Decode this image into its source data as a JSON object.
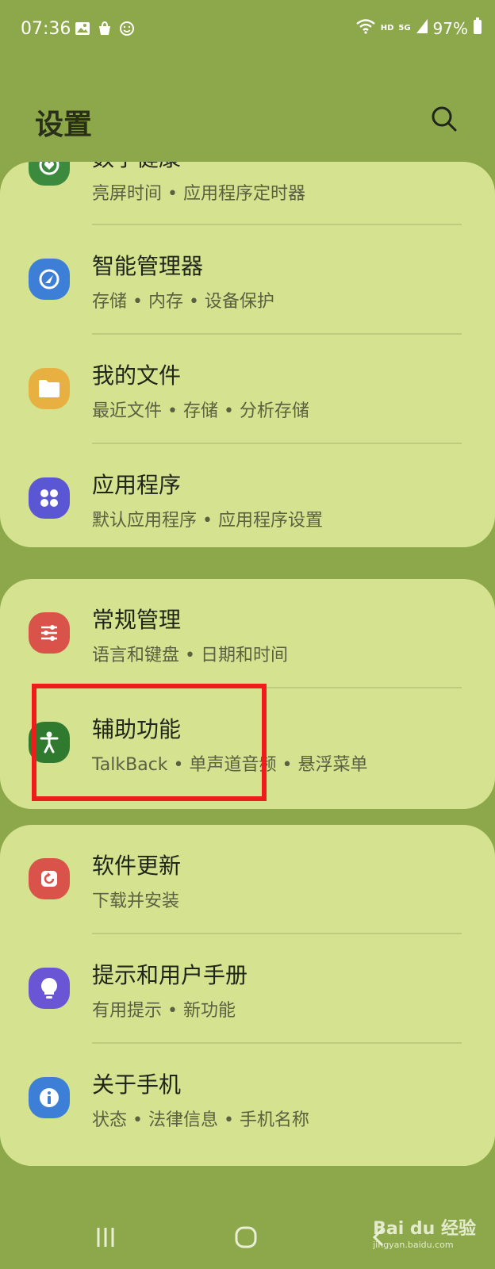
{
  "status_bar": {
    "time": "07:36",
    "network_tag_hd": "HD",
    "network_tag_5g": "5G",
    "battery": "97%",
    "left_icons": [
      "image-icon",
      "shopping-bag-icon",
      "smiley-icon"
    ],
    "right_icons": [
      "wifi-icon",
      "signal-icon",
      "battery-icon"
    ]
  },
  "header": {
    "title": "设置",
    "search_icon": "search-icon"
  },
  "group1": {
    "items": [
      {
        "title": "数字健康",
        "subtitle": "亮屏时间 • 应用程序定时器",
        "icon": "digital-wellbeing-icon",
        "color": "#3c8a3e"
      },
      {
        "title": "智能管理器",
        "subtitle": "存储 • 内存 • 设备保护",
        "icon": "device-care-icon",
        "color": "#3d7fd6"
      },
      {
        "title": "我的文件",
        "subtitle": "最近文件 • 存储 • 分析存储",
        "icon": "folder-icon",
        "color": "#e8b040"
      },
      {
        "title": "应用程序",
        "subtitle": "默认应用程序 • 应用程序设置",
        "icon": "apps-icon",
        "color": "#5a56d4"
      }
    ]
  },
  "group2": {
    "items": [
      {
        "title": "常规管理",
        "subtitle": "语言和键盘 • 日期和时间",
        "icon": "sliders-icon",
        "color": "#d9534a"
      },
      {
        "title": "辅助功能",
        "subtitle": "TalkBack • 单声道音频 • 悬浮菜单",
        "icon": "accessibility-icon",
        "color": "#2f7a2e"
      }
    ]
  },
  "group3": {
    "items": [
      {
        "title": "软件更新",
        "subtitle": "下载并安装",
        "icon": "software-update-icon",
        "color": "#d9534a"
      },
      {
        "title": "提示和用户手册",
        "subtitle": "有用提示 • 新功能",
        "icon": "lightbulb-icon",
        "color": "#6a56d4"
      },
      {
        "title": "关于手机",
        "subtitle": "状态 • 法律信息 • 手机名称",
        "icon": "info-icon",
        "color": "#3d7fd6"
      }
    ]
  },
  "nav": {
    "recent_icon": "recent-apps-icon",
    "home_icon": "home-icon",
    "back_icon": "back-icon"
  },
  "watermark": {
    "text": "Bai du 经验",
    "sub": "jingyan.baidu.com"
  }
}
